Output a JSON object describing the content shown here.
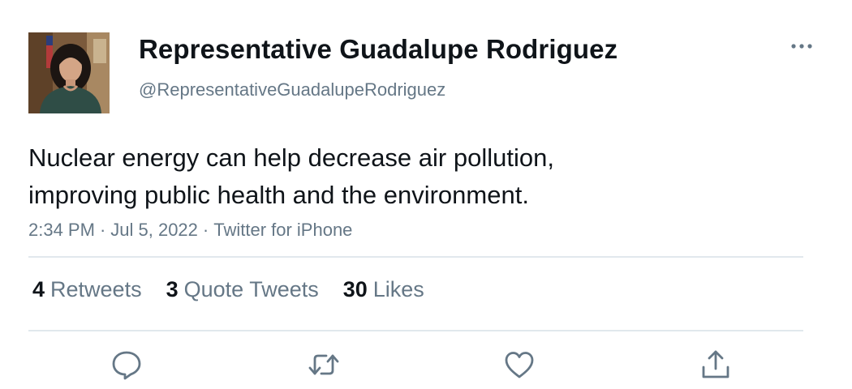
{
  "author": {
    "display_name": "Representative Guadalupe Rodriguez",
    "handle": "@RepresentativeGuadalupeRodriguez"
  },
  "tweet": {
    "text_lines": [
      "Nuclear energy can help decrease air pollution,",
      "improving public health and the environment."
    ]
  },
  "meta": {
    "time": "2:34 PM",
    "separator": "·",
    "date": "Jul 5, 2022",
    "source": "Twitter for iPhone"
  },
  "stats": {
    "retweets": {
      "count": "4",
      "label": "Retweets"
    },
    "quote_tweets": {
      "count": "3",
      "label": "Quote Tweets"
    },
    "likes": {
      "count": "30",
      "label": "Likes"
    }
  },
  "icons": {
    "more": "more-horizontal-icon",
    "reply": "reply-icon",
    "retweet": "retweet-icon",
    "like": "heart-icon",
    "share": "share-icon"
  },
  "colors": {
    "text": "#0f1419",
    "secondary": "#657786",
    "divider": "#e1e8ed"
  }
}
